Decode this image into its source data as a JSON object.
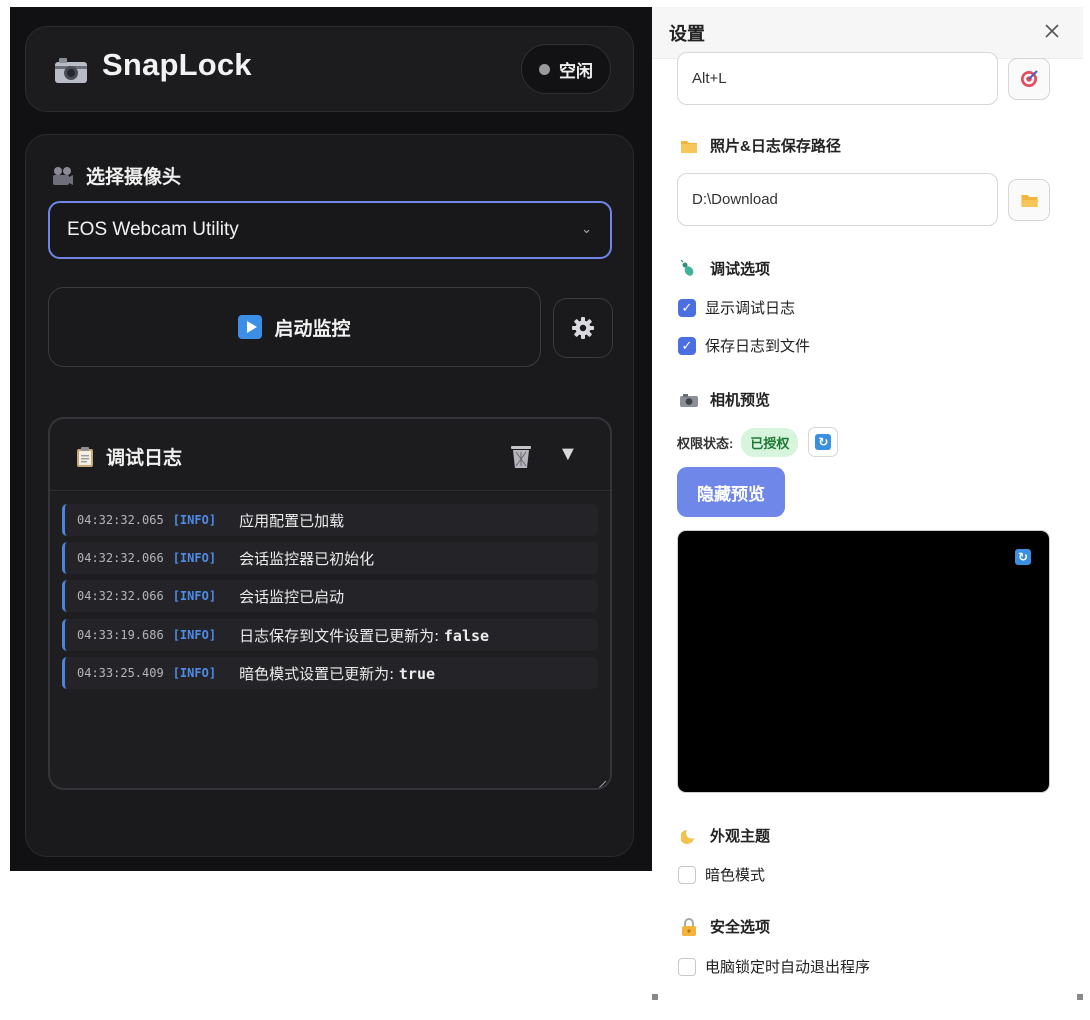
{
  "app": {
    "name": "SnapLock",
    "status": "空闲",
    "camera_section_label": "选择摄像头",
    "selected_camera": "EOS Webcam Utility",
    "start_button_label": "启动监控",
    "log_title": "调试日志",
    "logs": [
      {
        "time": "04:32:32.065",
        "level": "[INFO]",
        "message": "应用配置已加载",
        "value": ""
      },
      {
        "time": "04:32:32.066",
        "level": "[INFO]",
        "message": "会话监控器已初始化",
        "value": ""
      },
      {
        "time": "04:32:32.066",
        "level": "[INFO]",
        "message": "会话监控已启动",
        "value": ""
      },
      {
        "time": "04:33:19.686",
        "level": "[INFO]",
        "message": "日志保存到文件设置已更新为: ",
        "value": "false"
      },
      {
        "time": "04:33:25.409",
        "level": "[INFO]",
        "message": "暗色模式设置已更新为: ",
        "value": "true"
      }
    ]
  },
  "settings": {
    "title": "设置",
    "hotkey_value": "Alt+L",
    "save_path_label": "照片&日志保存路径",
    "save_path_value": "D:\\Download",
    "debug_label": "调试选项",
    "show_debug_log": {
      "label": "显示调试日志",
      "checked": true
    },
    "save_log_to_file": {
      "label": "保存日志到文件",
      "checked": true
    },
    "preview_label": "相机预览",
    "permission_label": "权限状态:",
    "permission_status": "已授权",
    "hide_preview_button": "隐藏预览",
    "theme_label": "外观主题",
    "dark_mode": {
      "label": "暗色模式",
      "checked": false
    },
    "security_label": "安全选项",
    "auto_exit_on_lock": {
      "label": "电脑锁定时自动退出程序",
      "checked": false
    }
  },
  "colors": {
    "accent": "#6e87e8",
    "log_level": "#4f8ce8",
    "permission_ok": "#1d7a35"
  },
  "icons": [
    "camera-icon",
    "film-camera-icon",
    "play-icon",
    "gear-icon",
    "clipboard-icon",
    "trash-icon",
    "triangle-down-icon",
    "close-icon",
    "target-icon",
    "folder-icon",
    "bug-icon",
    "moon-icon",
    "lock-icon",
    "refresh-icon"
  ]
}
